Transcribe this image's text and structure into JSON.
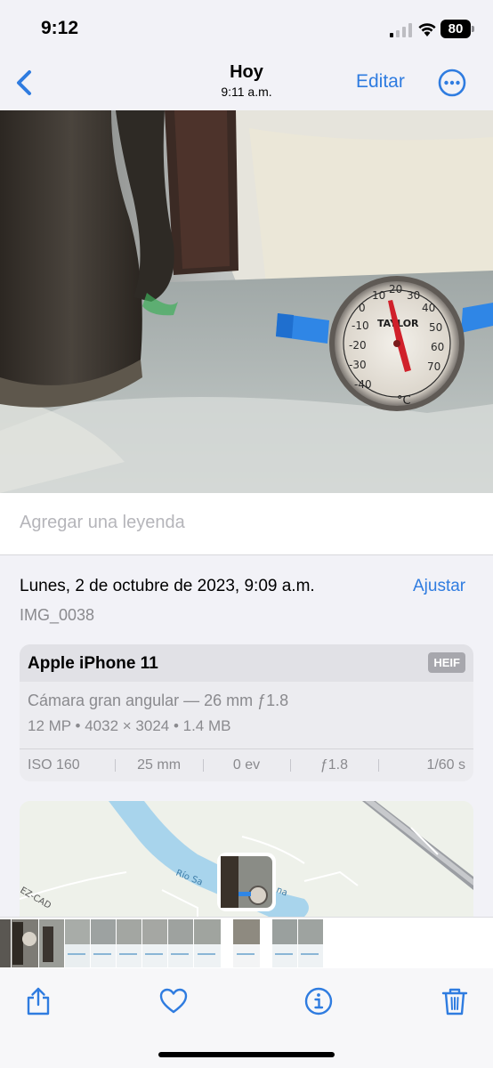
{
  "status_bar": {
    "time": "9:12",
    "battery": "80"
  },
  "nav": {
    "title": "Hoy",
    "subtitle": "9:11 a.m.",
    "edit_label": "Editar"
  },
  "photo": {
    "brand_on_thermometer": "TAYLOR",
    "unit": "°C",
    "scale_labels": [
      "-40",
      "-30",
      "-20",
      "-10",
      "0",
      "10",
      "20",
      "30",
      "40",
      "50",
      "60",
      "70"
    ]
  },
  "caption": {
    "placeholder": "Agregar una leyenda"
  },
  "details": {
    "date": "Lunes, 2 de octubre de 2023, 9:09 a.m.",
    "adjust_label": "Ajustar",
    "filename": "IMG_0038"
  },
  "camera": {
    "device": "Apple iPhone 11",
    "format": "HEIF",
    "lens": "Cámara gran angular — 26 mm ƒ1.8",
    "specs": "12 MP  •  4032 × 3024  •  1.4 MB",
    "exif": [
      "ISO 160",
      "25 mm",
      "0 ev",
      "ƒ1.8",
      "1/60 s"
    ]
  },
  "map": {
    "river_label": "Río Sa",
    "river_label_end": "na",
    "road_label": "EZ-CAD"
  },
  "colors": {
    "accent": "#2f7ce0",
    "background": "#f2f2f7",
    "water": "#a8d4ec"
  },
  "icons": [
    "back-chevron-icon",
    "more-icon",
    "share-icon",
    "heart-icon",
    "info-icon",
    "trash-icon"
  ]
}
